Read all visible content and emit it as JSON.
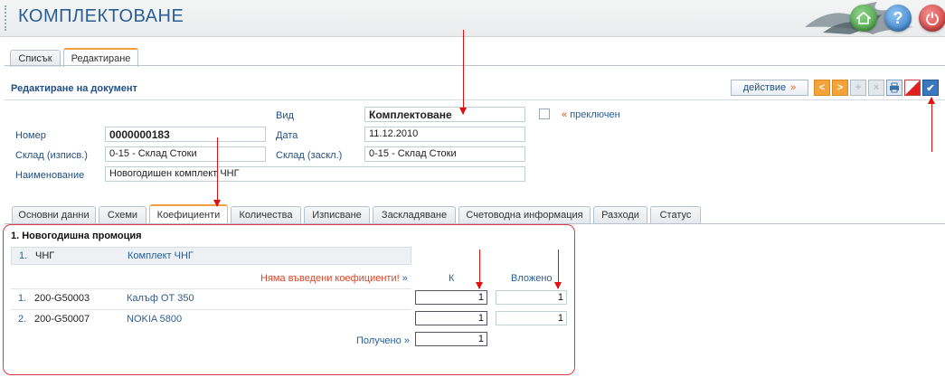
{
  "app": {
    "title": "КОМПЛЕКТОВАНЕ"
  },
  "header_buttons": {
    "help_glyph": "?"
  },
  "top_tabs": [
    {
      "label": "Списък"
    },
    {
      "label": "Редактиране"
    }
  ],
  "document": {
    "title": "Редактиране на документ",
    "action_label": "действие",
    "action_chevron": "»"
  },
  "form": {
    "kind_label": "Вид",
    "kind_value": "Комплектоване",
    "switched_label": "преключен",
    "switched_quote": "«",
    "number_label": "Номер",
    "number_value": "0000000183",
    "date_label": "Дата",
    "date_value": "11.12.2010",
    "store_out_label": "Склад (изписв.)",
    "store_out_value": "0-15 - Склад Стоки",
    "store_in_label": "Склад (заскл.)",
    "store_in_value": "0-15 - Склад Стоки",
    "name_label": "Наименование",
    "name_value": "Новогодишен комплект ЧНГ"
  },
  "sub_tabs": [
    {
      "label": "Основни данни"
    },
    {
      "label": "Схеми"
    },
    {
      "label": "Коефициенти"
    },
    {
      "label": "Количества"
    },
    {
      "label": "Изписване"
    },
    {
      "label": "Заскладяване"
    },
    {
      "label": "Счетоводна информация"
    },
    {
      "label": "Разходи"
    },
    {
      "label": "Статус"
    }
  ],
  "promo": {
    "title": "1. Новогодишна промоция",
    "header": {
      "num": "1.",
      "code": "ЧНГ",
      "name": "Комплект ЧНГ"
    },
    "warning": "Няма въведени коефициенти!",
    "warning_quote": "»",
    "col_k": "К",
    "col_invested": "Вложено",
    "items": [
      {
        "num": "1.",
        "code": "200-G50003",
        "name": "Калъф ОТ 350",
        "k": "1",
        "invested": "1"
      },
      {
        "num": "2.",
        "code": "200-G50007",
        "name": "NOKIA 5800",
        "k": "1",
        "invested": "1"
      }
    ],
    "received_label": "Получено",
    "received_quote": "»",
    "received_value": "1"
  },
  "colors": {
    "brand": "#2a5f95",
    "accent": "#f0a040",
    "annotation_red": "#e01010"
  },
  "icons": [
    "home-icon",
    "help-icon",
    "power-icon",
    "prev-icon",
    "next-icon",
    "add-icon",
    "delete-icon",
    "print-icon",
    "flag-icon",
    "confirm-icon"
  ]
}
